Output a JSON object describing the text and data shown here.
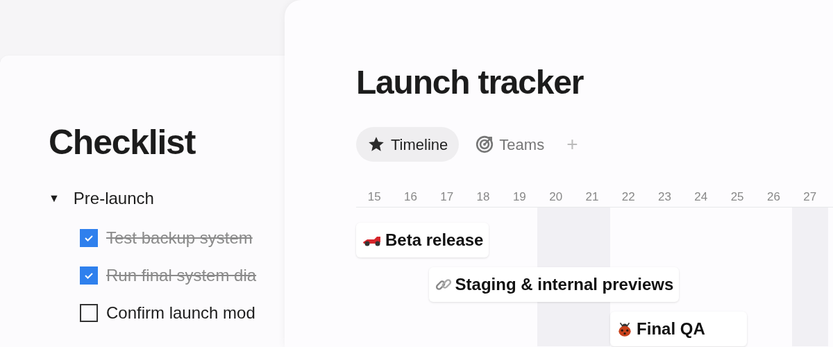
{
  "checklist": {
    "title": "Checklist",
    "groups": [
      {
        "toggle": "▼",
        "label": "Pre-launch",
        "items": [
          {
            "label": "Test backup system",
            "checked": true
          },
          {
            "label": "Run final system dia",
            "checked": true
          },
          {
            "label": "Confirm launch mod",
            "checked": false
          }
        ]
      }
    ]
  },
  "tracker": {
    "title": "Launch tracker",
    "tabs": [
      {
        "label": "Timeline",
        "selected": true
      },
      {
        "label": "Teams",
        "selected": false
      }
    ],
    "add_tab": "+",
    "days": [
      {
        "label": "15",
        "weekend": false
      },
      {
        "label": "16",
        "weekend": false
      },
      {
        "label": "17",
        "weekend": false
      },
      {
        "label": "18",
        "weekend": false
      },
      {
        "label": "19",
        "weekend": false
      },
      {
        "label": "20",
        "weekend": true
      },
      {
        "label": "21",
        "weekend": true
      },
      {
        "label": "22",
        "weekend": false
      },
      {
        "label": "23",
        "weekend": false
      },
      {
        "label": "24",
        "weekend": false
      },
      {
        "label": "25",
        "weekend": false
      },
      {
        "label": "26",
        "weekend": false
      },
      {
        "label": "27",
        "weekend": true
      }
    ],
    "items": [
      {
        "label": "Beta release"
      },
      {
        "label": "Staging & internal previews"
      },
      {
        "label": "Final QA"
      }
    ]
  }
}
